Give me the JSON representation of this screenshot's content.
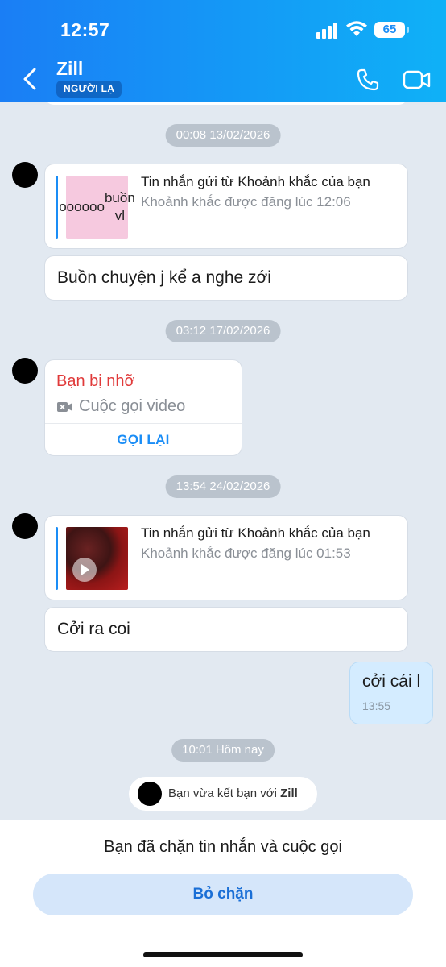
{
  "status_bar": {
    "time": "12:57",
    "battery": "65"
  },
  "header": {
    "contact_name": "Zill",
    "badge": "NGƯỜI LẠ"
  },
  "chat": {
    "timestamps": [
      "00:08 13/02/2026",
      "03:12 17/02/2026",
      "13:54 24/02/2026",
      "10:01 Hôm nay"
    ],
    "moment_1": {
      "thumb_text": "oooooo buồn vl",
      "title": "Tin nhắn gửi từ Khoảnh khắc của bạn",
      "subtitle": "Khoảnh khắc được đăng lúc 12:06"
    },
    "message_1": "Buồn chuyện j kể a nghe zới",
    "missed_call": {
      "title": "Bạn bị nhỡ",
      "subtitle": "Cuộc gọi video",
      "callback": "GỌI LẠI"
    },
    "moment_2": {
      "title": "Tin nhắn gửi từ Khoảnh khắc của bạn",
      "subtitle": "Khoảnh khắc được đăng lúc 01:53"
    },
    "message_2": "Cởi ra coi",
    "outgoing": {
      "text": "cởi cái l",
      "time": "13:55"
    },
    "friend_notice": {
      "prefix": "Bạn vừa kết bạn với ",
      "name": "Zill"
    }
  },
  "blocked": {
    "text": "Bạn đã chặn tin nhắn và cuộc gọi",
    "unblock_label": "Bỏ chặn"
  },
  "colors": {
    "header_start": "#1a7ef5",
    "header_end": "#0fb1f7",
    "accent": "#1a8df6",
    "missed": "#e03a3a"
  }
}
